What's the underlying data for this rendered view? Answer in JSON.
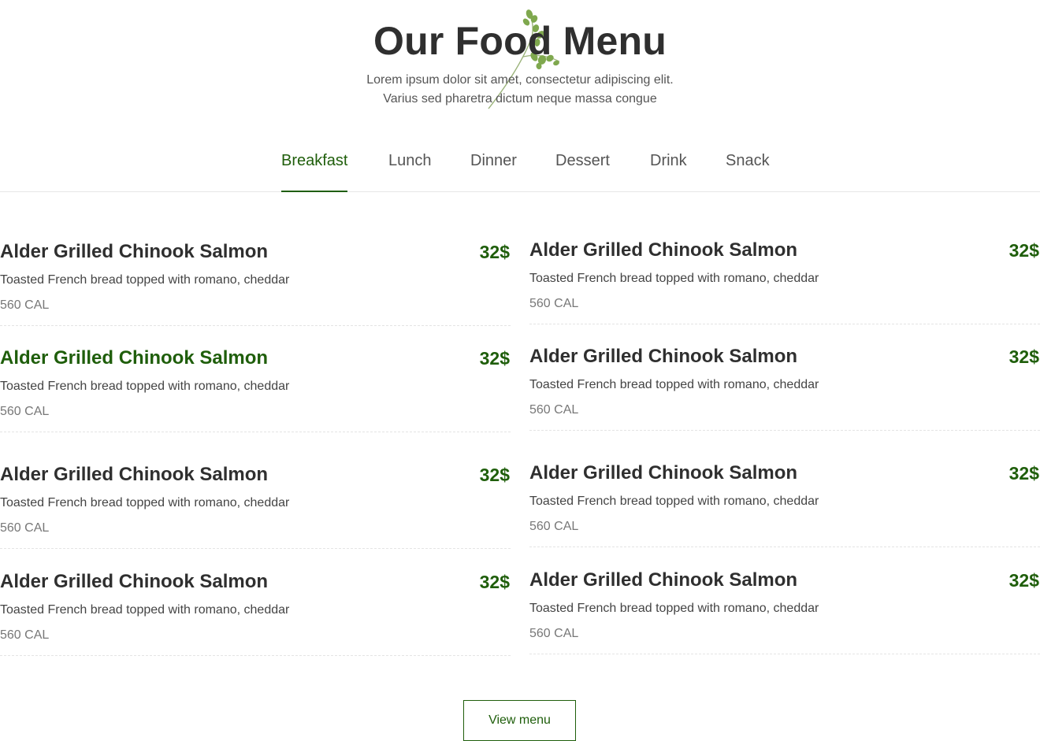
{
  "header": {
    "title": "Our Food Menu",
    "subtitle_line1": "Lorem ipsum dolor sit amet, consectetur adipiscing elit.",
    "subtitle_line2": "Varius sed pharetra dictum neque massa congue",
    "decoration_icon": "herb-sprig-icon"
  },
  "tabs": [
    {
      "label": "Breakfast",
      "active": true
    },
    {
      "label": "Lunch"
    },
    {
      "label": "Dinner"
    },
    {
      "label": "Dessert"
    },
    {
      "label": "Drink"
    },
    {
      "label": "Snack"
    }
  ],
  "menu_items": [
    {
      "name": "Alder Grilled Chinook Salmon",
      "price": "32$",
      "description": "Toasted French bread topped with romano, cheddar",
      "calories": "560 CAL"
    },
    {
      "name": "Alder Grilled Chinook Salmon",
      "price": "32$",
      "description": "Toasted French bread topped with romano, cheddar",
      "calories": "560 CAL"
    },
    {
      "name": "Alder Grilled Chinook Salmon",
      "price": "32$",
      "description": "Toasted French bread topped with romano, cheddar",
      "calories": "560 CAL",
      "highlighted": true
    },
    {
      "name": "Alder Grilled Chinook Salmon",
      "price": "32$",
      "description": "Toasted French bread topped with romano, cheddar",
      "calories": "560 CAL"
    },
    {
      "name": "Alder Grilled Chinook Salmon",
      "price": "32$",
      "description": "Toasted French bread topped with romano, cheddar",
      "calories": "560 CAL"
    },
    {
      "name": "Alder Grilled Chinook Salmon",
      "price": "32$",
      "description": "Toasted French bread topped with romano, cheddar",
      "calories": "560 CAL"
    },
    {
      "name": "Alder Grilled Chinook Salmon",
      "price": "32$",
      "description": "Toasted French bread topped with romano, cheddar",
      "calories": "560 CAL"
    },
    {
      "name": "Alder Grilled Chinook Salmon",
      "price": "32$",
      "description": "Toasted French bread topped with romano, cheddar",
      "calories": "560 CAL"
    }
  ],
  "view_menu_label": "View menu",
  "colors": {
    "accent": "#1f5e0b",
    "heading": "#2f2f2f",
    "text": "#444444",
    "muted": "#777777",
    "divider": "#e4e4e4"
  }
}
